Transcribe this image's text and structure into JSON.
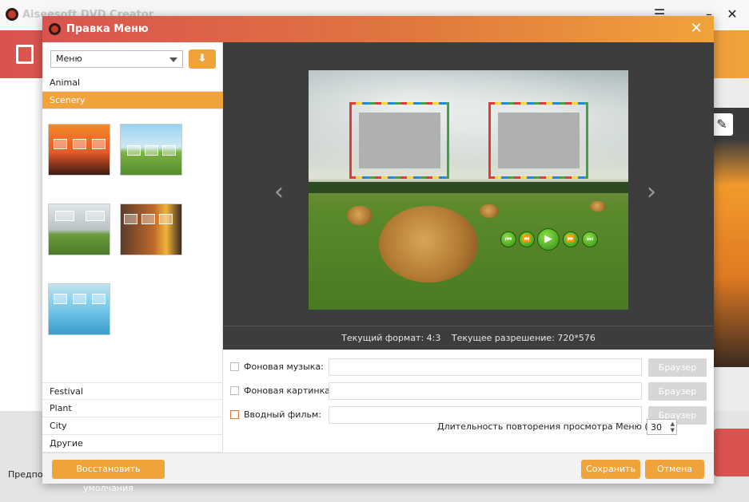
{
  "background_app": {
    "title": "Aiseesoft DVD Creator",
    "bottom_text": "Предпол"
  },
  "dialog": {
    "title": "Правка Меню",
    "close_glyph": "✕"
  },
  "left_panel": {
    "menu_select": {
      "value": "Меню"
    },
    "download_glyph": "⬇",
    "categories_top": [
      {
        "label": "Animal",
        "selected": false
      },
      {
        "label": "Scenery",
        "selected": true
      }
    ],
    "categories_bottom": [
      {
        "label": "Festival"
      },
      {
        "label": "Plant"
      },
      {
        "label": "City"
      },
      {
        "label": "Другие"
      }
    ]
  },
  "preview": {
    "prev_glyph": "‹",
    "next_glyph": "›",
    "controls": [
      "⏮",
      "⏪",
      "▶",
      "⏩",
      "⏭"
    ]
  },
  "format_bar": {
    "format": "Текущий формат: 4:3",
    "resolution": "Текущее разрешение: 720*576"
  },
  "options": [
    {
      "label": "Фоновая музыка:",
      "browse": "Браузер",
      "checked": false
    },
    {
      "label": "Фоновая картинка:",
      "browse": "Браузер",
      "checked": false
    },
    {
      "label": "Вводный фильм:",
      "browse": "Браузер",
      "checked": false
    }
  ],
  "repeat": {
    "label": "Длительность повторения просмотра Меню (сек):",
    "value": "30"
  },
  "footer": {
    "restore_label": "Восстановить умолчания",
    "save_label": "Сохранить",
    "cancel_label": "Отмена"
  },
  "colors": {
    "accent": "#f0a33a",
    "header_start": "#d9534f",
    "header_end": "#f0a33a"
  }
}
